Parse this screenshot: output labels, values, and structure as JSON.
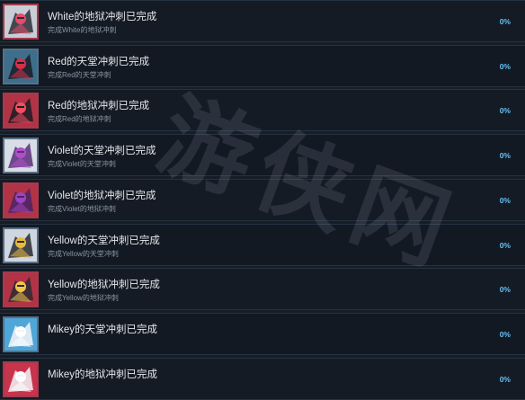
{
  "achievements": [
    {
      "title": "White的地狱冲刺已完成",
      "description": "完成White的地狱冲刺",
      "percent": "0%",
      "icon": "white-hell-dash-icon",
      "bg": "#c8cdd6",
      "fg": "#2b2f38",
      "accent": "#e84a6a",
      "frame": "#a33b4e"
    },
    {
      "title": "Red的天堂冲刺已完成",
      "description": "完成Red的天堂冲刺",
      "percent": "0%",
      "icon": "red-heaven-dash-icon",
      "bg": "#3d6f8c",
      "fg": "#1a1c24",
      "accent": "#d33049",
      "frame": "#5a6f86"
    },
    {
      "title": "Red的地狱冲刺已完成",
      "description": "完成Red的地狱冲刺",
      "percent": "0%",
      "icon": "red-hell-dash-icon",
      "bg": "#b23346",
      "fg": "#1a1c24",
      "accent": "#f04f62",
      "frame": "#a33b4e"
    },
    {
      "title": "Violet的天堂冲刺已完成",
      "description": "完成Violet的天堂冲刺",
      "percent": "0%",
      "icon": "violet-heaven-dash-icon",
      "bg": "#d8dde6",
      "fg": "#5a2f7a",
      "accent": "#b04fc8",
      "frame": "#5a6f86"
    },
    {
      "title": "Violet的地狱冲刺已完成",
      "description": "完成Violet的地狱冲刺",
      "percent": "0%",
      "icon": "violet-hell-dash-icon",
      "bg": "#b23346",
      "fg": "#4a2566",
      "accent": "#9b46c0",
      "frame": "#a33b4e"
    },
    {
      "title": "Yellow的天堂冲刺已完成",
      "description": "完成Yellow的天堂冲刺",
      "percent": "0%",
      "icon": "yellow-heaven-dash-icon",
      "bg": "#cfd6e0",
      "fg": "#2a2c33",
      "accent": "#e8b93a",
      "frame": "#5a6f86"
    },
    {
      "title": "Yellow的地狱冲刺已完成",
      "description": "完成Yellow的地狱冲刺",
      "percent": "0%",
      "icon": "yellow-hell-dash-icon",
      "bg": "#b23346",
      "fg": "#2a2c33",
      "accent": "#f0c64a",
      "frame": "#a33b4e"
    },
    {
      "title": "Mikey的天堂冲刺已完成",
      "description": "",
      "percent": "0%",
      "icon": "mikey-heaven-dash-icon",
      "bg": "#4fa6d8",
      "fg": "#f2f4f8",
      "accent": "#ffffff",
      "frame": "#5a6f86"
    },
    {
      "title": "Mikey的地狱冲刺已完成",
      "description": "",
      "percent": "0%",
      "icon": "mikey-hell-dash-icon",
      "bg": "#c7344c",
      "fg": "#f2f4f8",
      "accent": "#ffffff",
      "frame": "#a33b4e"
    }
  ],
  "watermark": "游侠网"
}
